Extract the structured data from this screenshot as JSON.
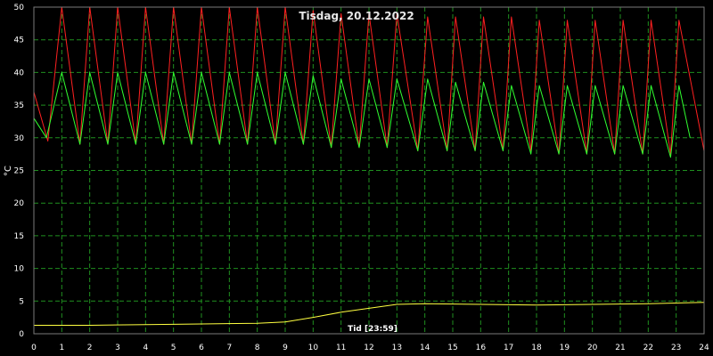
{
  "chart_data": {
    "type": "line",
    "title": "Tisdag, 20.12.2022",
    "xlabel": "Tid [23:59]",
    "ylabel": "°C",
    "xlim": [
      0,
      24
    ],
    "ylim": [
      0,
      50
    ],
    "x_ticks": [
      0,
      1,
      2,
      3,
      4,
      5,
      6,
      7,
      8,
      9,
      10,
      11,
      12,
      13,
      14,
      15,
      16,
      17,
      18,
      19,
      20,
      21,
      22,
      23,
      24
    ],
    "y_ticks": [
      0,
      5,
      10,
      15,
      20,
      25,
      30,
      35,
      40,
      45,
      50
    ],
    "grid": true,
    "background": "#000000",
    "grid_color": "#1f8f1f",
    "series": [
      {
        "color": "#ff2020",
        "points": [
          [
            0.0,
            37
          ],
          [
            0.5,
            29.5
          ],
          [
            1.0,
            50
          ],
          [
            1.65,
            29
          ],
          [
            2.0,
            50
          ],
          [
            2.65,
            29
          ],
          [
            3.0,
            50
          ],
          [
            3.65,
            29
          ],
          [
            4.0,
            50
          ],
          [
            4.65,
            29
          ],
          [
            5.0,
            50
          ],
          [
            5.65,
            29
          ],
          [
            6.0,
            50
          ],
          [
            6.65,
            29
          ],
          [
            7.0,
            50
          ],
          [
            7.65,
            29
          ],
          [
            8.0,
            50
          ],
          [
            8.65,
            29
          ],
          [
            9.0,
            50
          ],
          [
            9.65,
            29
          ],
          [
            10.0,
            49.5
          ],
          [
            10.65,
            28.5
          ],
          [
            11.0,
            49
          ],
          [
            11.65,
            28.5
          ],
          [
            12.0,
            49
          ],
          [
            12.65,
            28.5
          ],
          [
            13.0,
            49
          ],
          [
            13.75,
            28
          ],
          [
            14.1,
            48.5
          ],
          [
            14.8,
            28
          ],
          [
            15.1,
            48.5
          ],
          [
            15.8,
            28
          ],
          [
            16.1,
            48.5
          ],
          [
            16.8,
            28
          ],
          [
            17.1,
            48.5
          ],
          [
            17.8,
            28
          ],
          [
            18.1,
            48
          ],
          [
            18.8,
            27.5
          ],
          [
            19.1,
            48
          ],
          [
            19.8,
            27.5
          ],
          [
            20.1,
            48
          ],
          [
            20.8,
            27.5
          ],
          [
            21.1,
            48
          ],
          [
            21.8,
            27.5
          ],
          [
            22.1,
            48
          ],
          [
            22.8,
            27.5
          ],
          [
            23.1,
            48
          ],
          [
            24.0,
            28
          ]
        ]
      },
      {
        "color": "#30ff30",
        "points": [
          [
            0.0,
            33
          ],
          [
            0.45,
            30
          ],
          [
            1.0,
            40
          ],
          [
            1.65,
            29
          ],
          [
            2.0,
            40
          ],
          [
            2.65,
            29
          ],
          [
            3.0,
            40
          ],
          [
            3.65,
            29
          ],
          [
            4.0,
            40
          ],
          [
            4.65,
            29
          ],
          [
            5.0,
            40
          ],
          [
            5.65,
            29
          ],
          [
            6.0,
            40
          ],
          [
            6.65,
            29
          ],
          [
            7.0,
            40
          ],
          [
            7.65,
            29
          ],
          [
            8.0,
            40
          ],
          [
            8.65,
            29
          ],
          [
            9.0,
            40
          ],
          [
            9.65,
            29
          ],
          [
            10.0,
            39.5
          ],
          [
            10.65,
            28.5
          ],
          [
            11.0,
            39
          ],
          [
            11.65,
            28.5
          ],
          [
            12.0,
            39
          ],
          [
            12.65,
            28.5
          ],
          [
            13.0,
            39
          ],
          [
            13.75,
            28
          ],
          [
            14.1,
            39
          ],
          [
            14.8,
            28
          ],
          [
            15.1,
            38.5
          ],
          [
            15.8,
            28
          ],
          [
            16.1,
            38.5
          ],
          [
            16.8,
            28
          ],
          [
            17.1,
            38
          ],
          [
            17.8,
            27.5
          ],
          [
            18.1,
            38
          ],
          [
            18.8,
            27.5
          ],
          [
            19.1,
            38
          ],
          [
            19.8,
            27.5
          ],
          [
            20.1,
            38
          ],
          [
            20.8,
            27.5
          ],
          [
            21.1,
            38
          ],
          [
            21.8,
            27.5
          ],
          [
            22.1,
            38
          ],
          [
            22.8,
            27
          ],
          [
            23.1,
            38
          ],
          [
            23.5,
            30
          ]
        ]
      },
      {
        "color": "#ffff40",
        "points": [
          [
            0,
            1.3
          ],
          [
            2,
            1.3
          ],
          [
            4,
            1.4
          ],
          [
            6,
            1.5
          ],
          [
            8,
            1.6
          ],
          [
            9,
            1.8
          ],
          [
            10,
            2.5
          ],
          [
            11,
            3.3
          ],
          [
            12,
            3.9
          ],
          [
            13,
            4.5
          ],
          [
            14,
            4.6
          ],
          [
            16,
            4.5
          ],
          [
            18,
            4.4
          ],
          [
            20,
            4.5
          ],
          [
            22,
            4.6
          ],
          [
            24,
            4.8
          ]
        ]
      }
    ]
  }
}
